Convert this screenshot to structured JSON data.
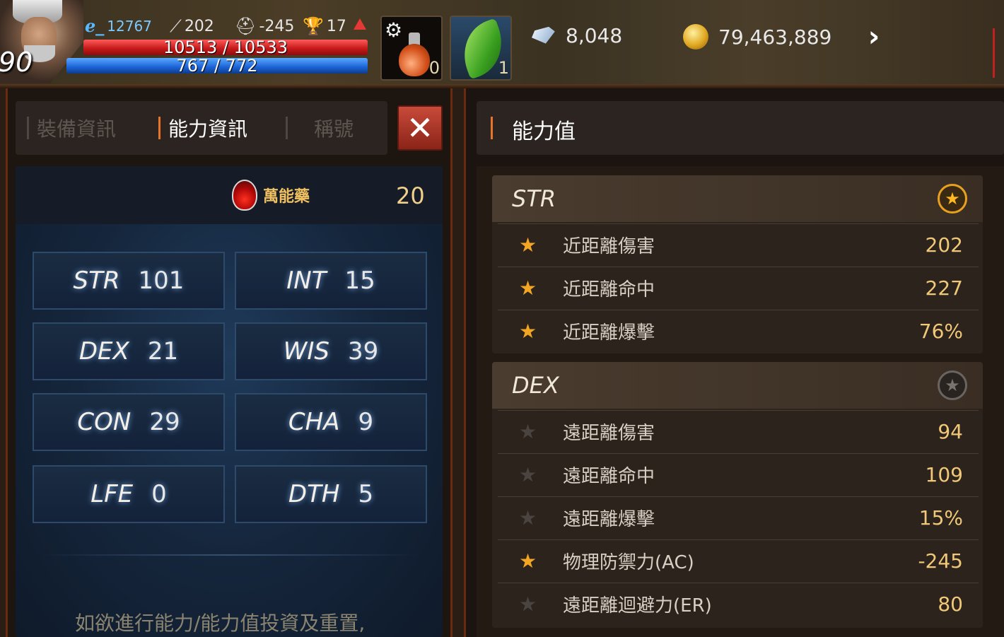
{
  "hud": {
    "level": "90",
    "exp": "12767",
    "attack": "202",
    "defense": "-245",
    "trophy": "17",
    "hp": "10513 / 10533",
    "mp": "767 / 772",
    "slot1_count": "0",
    "slot2_count": "1",
    "diamonds": "8,048",
    "gold": "79,463,889"
  },
  "tabs": [
    "裝備資訊",
    "能力資訊",
    "稱號"
  ],
  "elixir": {
    "label": "萬能藥",
    "count": "20"
  },
  "stats": [
    {
      "name": "STR",
      "value": "101"
    },
    {
      "name": "INT",
      "value": "15"
    },
    {
      "name": "DEX",
      "value": "21"
    },
    {
      "name": "WIS",
      "value": "39"
    },
    {
      "name": "CON",
      "value": "29"
    },
    {
      "name": "CHA",
      "value": "9"
    },
    {
      "name": "LFE",
      "value": "0"
    },
    {
      "name": "DTH",
      "value": "5"
    }
  ],
  "hint": "如欲進行能力/能力值投資及重置,",
  "right": {
    "title": "能力值",
    "groups": [
      {
        "name": "STR",
        "badge": "gold",
        "rows": [
          {
            "label": "近距離傷害",
            "value": "202",
            "star": true
          },
          {
            "label": "近距離命中",
            "value": "227",
            "star": true
          },
          {
            "label": "近距離爆擊",
            "value": "76%",
            "star": true
          }
        ]
      },
      {
        "name": "DEX",
        "badge": "grey",
        "rows": [
          {
            "label": "遠距離傷害",
            "value": "94",
            "star": false
          },
          {
            "label": "遠距離命中",
            "value": "109",
            "star": false
          },
          {
            "label": "遠距離爆擊",
            "value": "15%",
            "star": false
          },
          {
            "label": "物理防禦力(AC)",
            "value": "-245",
            "star": true
          },
          {
            "label": "遠距離迴避力(ER)",
            "value": "80",
            "star": false
          }
        ]
      }
    ]
  }
}
